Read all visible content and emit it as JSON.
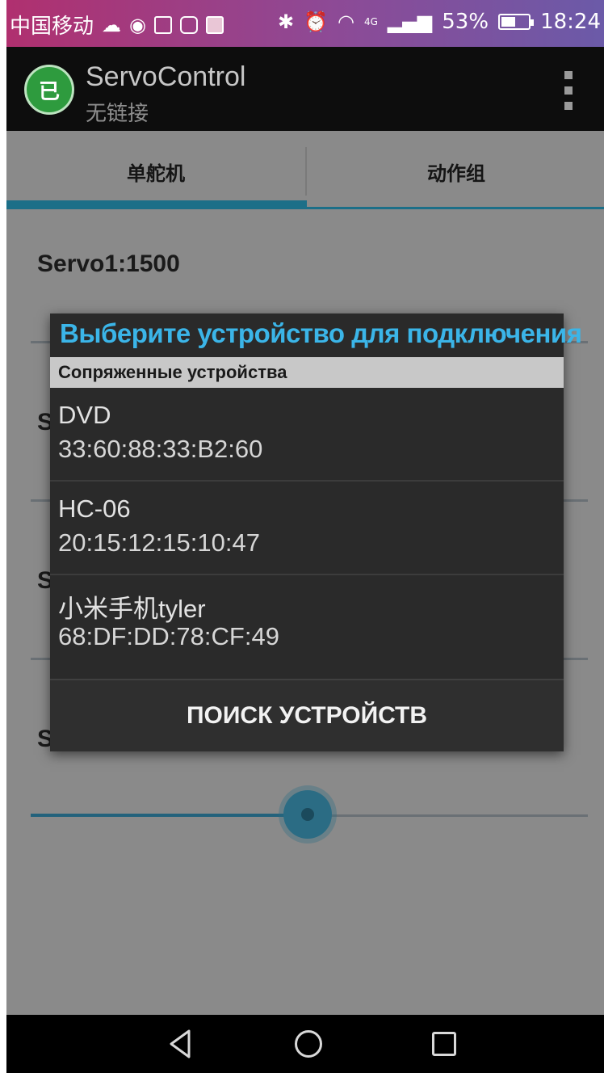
{
  "status_bar": {
    "carrier": "中国移动",
    "network": "4G",
    "battery": "53%",
    "battery_level": 0.53,
    "time": "18:24"
  },
  "action_bar": {
    "app_icon_text": "已",
    "title": "ServoControl",
    "subtitle": "无链接"
  },
  "tabs": [
    {
      "label": "单舵机",
      "selected": true
    },
    {
      "label": "动作组",
      "selected": false
    }
  ],
  "content": {
    "servo_labels": [
      "Servo1:1500",
      "S",
      "S",
      "S"
    ],
    "slider_level": 0.5
  },
  "dialog": {
    "title": "Выберите устройство для подключения",
    "section": "Сопряженные устройства",
    "devices": [
      {
        "name": "DVD",
        "address": "33:60:88:33:B2:60"
      },
      {
        "name": "HC-06",
        "address": "20:15:12:15:10:47"
      },
      {
        "name": "小米手机tyler",
        "address": "68:DF:DD:78:CF:49"
      }
    ],
    "scan_button": "ПОИСК УСТРОЙСТВ"
  },
  "colors": {
    "accent": "#3bb5e8",
    "tab_indicator": "#1c6f88"
  }
}
